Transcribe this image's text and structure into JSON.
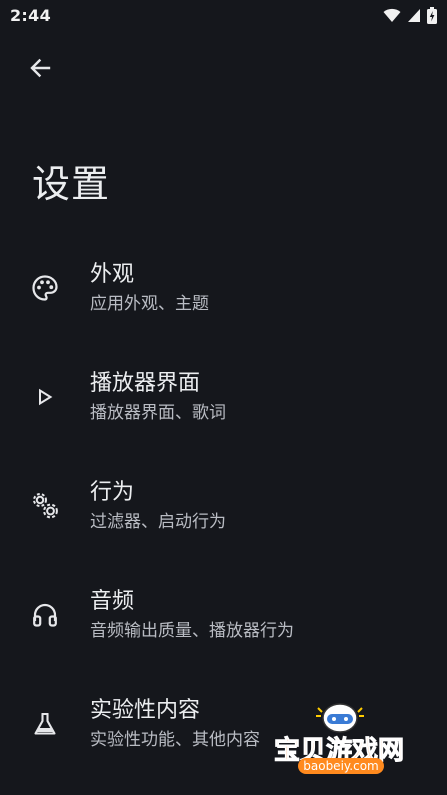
{
  "status_bar": {
    "time": "2:44",
    "icons": [
      "wifi-icon",
      "signal-icon",
      "battery-icon"
    ]
  },
  "header": {
    "back_icon": "arrow-back-icon",
    "title": "设置"
  },
  "settings": [
    {
      "icon": "palette-icon",
      "title": "外观",
      "subtitle": "应用外观、主题"
    },
    {
      "icon": "play-icon",
      "title": "播放器界面",
      "subtitle": "播放器界面、歌词"
    },
    {
      "icon": "gears-icon",
      "title": "行为",
      "subtitle": "过滤器、启动行为"
    },
    {
      "icon": "headphones-icon",
      "title": "音频",
      "subtitle": "音频输出质量、播放器行为"
    },
    {
      "icon": "flask-icon",
      "title": "实验性内容",
      "subtitle": "实验性功能、其他内容"
    }
  ],
  "watermark": {
    "text": "宝贝游戏网",
    "url": "baobeiy.com"
  },
  "colors": {
    "background": "#15171c",
    "text_primary": "#eceef0",
    "text_secondary": "#b9bcc3",
    "watermark_orange": "#ff7a14"
  }
}
